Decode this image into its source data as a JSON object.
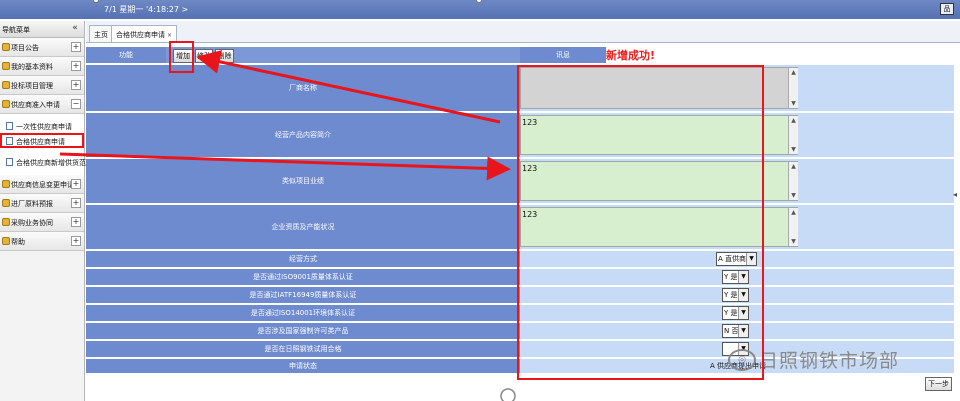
{
  "header": {
    "datetime": "7/1 星期一 '4:18:27 >"
  },
  "sidebar": {
    "title": "导航菜单",
    "collapse_glyph": "«",
    "menus": [
      {
        "label": "项目公告",
        "toggle": "+"
      },
      {
        "label": "我的基本资料",
        "toggle": "+"
      },
      {
        "label": "投标项目管理",
        "toggle": "+"
      },
      {
        "label": "供应商准入申请",
        "toggle": "−"
      }
    ],
    "submenus": [
      {
        "label": "一次性供应商申请"
      },
      {
        "label": "合格供应商申请"
      },
      {
        "label": "合格供应商新增供货范围申"
      }
    ],
    "menus_after": [
      {
        "label": "供应商信息变更申请",
        "toggle": "+"
      },
      {
        "label": "进厂原料预报",
        "toggle": "+"
      },
      {
        "label": "采购业务协同",
        "toggle": "+"
      },
      {
        "label": "帮助",
        "toggle": "+"
      }
    ]
  },
  "tabs": [
    {
      "label": "主页"
    },
    {
      "label": "合格供应商申请",
      "close": "×"
    }
  ],
  "toolbar": {
    "func_label": "功能",
    "add_label": "增加",
    "edit_label": "修改",
    "delete_label": "删除",
    "info_label": "讯息",
    "message": "新增成功!"
  },
  "fields": {
    "factory_name": {
      "label": "厂商名称",
      "value": ""
    },
    "products": {
      "label": "经营产品内容简介",
      "value": "123"
    },
    "projects": {
      "label": "类似项目业绩",
      "value": "123"
    },
    "qualification": {
      "label": "企业资质及产能状况",
      "value": "123"
    }
  },
  "selects": [
    {
      "label": "经营方式",
      "value": "A 直供商"
    },
    {
      "label": "是否通过ISO9001质量体系认证",
      "value": "Y 是"
    },
    {
      "label": "是否通过IATF16949质量体系认证",
      "value": "Y 是"
    },
    {
      "label": "是否通过ISO14001环境体系认证",
      "value": "Y 是"
    },
    {
      "label": "是否涉及国家强制许可类产品",
      "value": "N 否"
    },
    {
      "label": "是否在日照钢铁试用合格",
      "value": ""
    }
  ],
  "status": {
    "label": "申请状态",
    "value": "A 供应商提出申请"
  },
  "next_label": "下一步",
  "watermark": {
    "logo": "◎",
    "text": "日照钢铁市场部"
  },
  "colors": {
    "header_blue": "#6e8bcf",
    "value_blue": "#c7daf6",
    "textarea_green": "#d7efcf",
    "highlight_red": "#e8151b"
  }
}
